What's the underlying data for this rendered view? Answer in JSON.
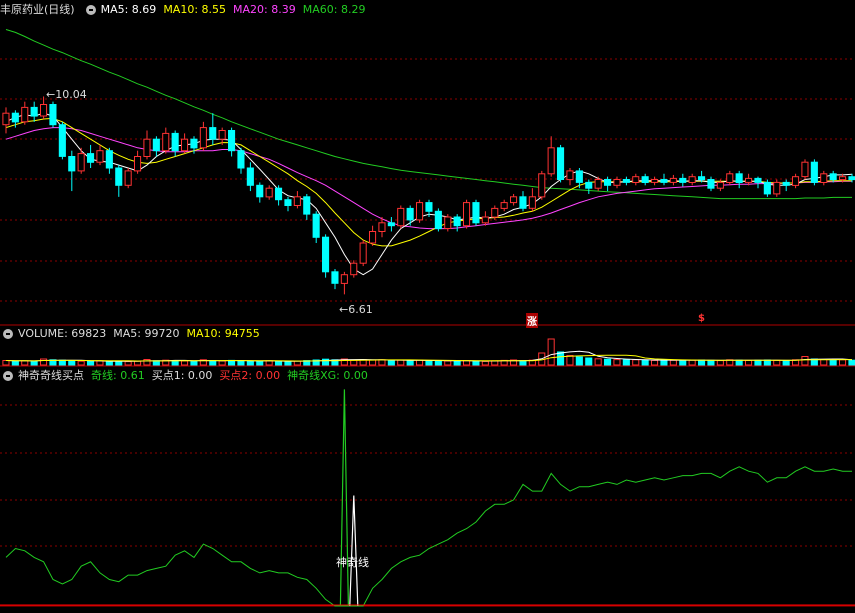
{
  "colors": {
    "ma5": "#ffffff",
    "ma10": "#ffff00",
    "ma20": "#ff44ff",
    "ma60": "#22cc22",
    "up": "#ff3333",
    "down": "#00ffff",
    "grid": "#8b0000",
    "qixian": "#22cc22"
  },
  "price_header": {
    "title": "丰原药业(日线)",
    "ma5": "MA5: 8.69",
    "ma10": "MA10: 8.55",
    "ma20": "MA20: 8.39",
    "ma60": "MA60: 8.29"
  },
  "volume_header": {
    "title": "VOLUME: 69823",
    "ma5": "MA5: 99720",
    "ma10": "MA10: 94755"
  },
  "indicator_header": {
    "title": "神奇奇线买点",
    "qixian": "奇线: 0.61",
    "buy1": "买点1: 0.00",
    "buy2": "买点2: 0.00",
    "xg": "神奇线XG: 0.00"
  },
  "annotations": {
    "high": "10.04",
    "low": "6.61",
    "indicator_label": "神奇线",
    "marker_zhang": "涨",
    "marker_dollar": "$"
  },
  "chart_data": [
    {
      "type": "candlestick",
      "title": "丰原药业(日线)",
      "ylim": [
        6.2,
        11.4
      ],
      "high_label": 10.04,
      "low_label": 6.61,
      "candles": [
        [
          9.55,
          9.75,
          9.4,
          9.85
        ],
        [
          9.75,
          9.6,
          9.5,
          9.8
        ],
        [
          9.6,
          9.85,
          9.55,
          9.95
        ],
        [
          9.85,
          9.7,
          9.6,
          9.95
        ],
        [
          9.7,
          9.9,
          9.65,
          10.04
        ],
        [
          9.9,
          9.55,
          9.5,
          9.95
        ],
        [
          9.55,
          9.0,
          8.95,
          9.6
        ],
        [
          9.0,
          8.75,
          8.4,
          9.1
        ],
        [
          8.75,
          9.05,
          8.7,
          9.15
        ],
        [
          9.05,
          8.9,
          8.8,
          9.2
        ],
        [
          8.9,
          9.1,
          8.85,
          9.2
        ],
        [
          9.1,
          8.8,
          8.7,
          9.15
        ],
        [
          8.8,
          8.5,
          8.3,
          8.85
        ],
        [
          8.5,
          8.75,
          8.45,
          8.8
        ],
        [
          8.75,
          9.0,
          8.7,
          9.1
        ],
        [
          9.0,
          9.3,
          8.95,
          9.45
        ],
        [
          9.3,
          9.1,
          9.0,
          9.35
        ],
        [
          9.1,
          9.4,
          9.05,
          9.5
        ],
        [
          9.4,
          9.1,
          9.0,
          9.45
        ],
        [
          9.1,
          9.3,
          9.05,
          9.4
        ],
        [
          9.3,
          9.15,
          9.05,
          9.35
        ],
        [
          9.15,
          9.5,
          9.1,
          9.6
        ],
        [
          9.5,
          9.3,
          9.2,
          9.75
        ],
        [
          9.3,
          9.45,
          9.2,
          9.5
        ],
        [
          9.45,
          9.1,
          9.0,
          9.5
        ],
        [
          9.1,
          8.8,
          8.7,
          9.15
        ],
        [
          8.8,
          8.5,
          8.4,
          8.9
        ],
        [
          8.5,
          8.3,
          8.2,
          8.55
        ],
        [
          8.3,
          8.45,
          8.25,
          8.5
        ],
        [
          8.45,
          8.25,
          8.15,
          8.5
        ],
        [
          8.25,
          8.15,
          8.05,
          8.3
        ],
        [
          8.15,
          8.3,
          8.1,
          8.4
        ],
        [
          8.3,
          8.0,
          7.9,
          8.35
        ],
        [
          8.0,
          7.6,
          7.5,
          8.05
        ],
        [
          7.6,
          7.0,
          6.9,
          7.65
        ],
        [
          7.0,
          6.8,
          6.7,
          7.05
        ],
        [
          6.8,
          6.95,
          6.61,
          7.0
        ],
        [
          6.95,
          7.15,
          6.9,
          7.2
        ],
        [
          7.15,
          7.5,
          7.1,
          7.55
        ],
        [
          7.5,
          7.7,
          7.45,
          7.8
        ],
        [
          7.7,
          7.85,
          7.6,
          7.95
        ],
        [
          7.85,
          7.8,
          7.7,
          7.95
        ],
        [
          7.8,
          8.1,
          7.75,
          8.15
        ],
        [
          8.1,
          7.9,
          7.8,
          8.15
        ],
        [
          7.9,
          8.2,
          7.85,
          8.25
        ],
        [
          8.2,
          8.05,
          7.95,
          8.25
        ],
        [
          8.05,
          7.75,
          7.7,
          8.1
        ],
        [
          7.75,
          7.95,
          7.7,
          8.0
        ],
        [
          7.95,
          7.8,
          7.7,
          8.0
        ],
        [
          7.8,
          8.2,
          7.75,
          8.25
        ],
        [
          8.2,
          7.85,
          7.8,
          8.25
        ],
        [
          7.85,
          7.95,
          7.8,
          8.05
        ],
        [
          7.95,
          8.1,
          7.9,
          8.15
        ],
        [
          8.1,
          8.2,
          8.05,
          8.25
        ],
        [
          8.2,
          8.3,
          8.15,
          8.35
        ],
        [
          8.3,
          8.1,
          8.05,
          8.4
        ],
        [
          8.1,
          8.3,
          8.05,
          8.45
        ],
        [
          8.3,
          8.7,
          8.25,
          8.75
        ],
        [
          8.7,
          9.15,
          8.65,
          9.35
        ],
        [
          9.15,
          8.6,
          8.55,
          9.2
        ],
        [
          8.6,
          8.75,
          8.5,
          8.8
        ],
        [
          8.75,
          8.55,
          8.45,
          8.8
        ],
        [
          8.55,
          8.45,
          8.35,
          8.6
        ],
        [
          8.45,
          8.6,
          8.4,
          8.65
        ],
        [
          8.6,
          8.5,
          8.4,
          8.65
        ],
        [
          8.5,
          8.6,
          8.45,
          8.65
        ],
        [
          8.6,
          8.55,
          8.5,
          8.65
        ],
        [
          8.55,
          8.65,
          8.5,
          8.7
        ],
        [
          8.65,
          8.55,
          8.5,
          8.7
        ],
        [
          8.55,
          8.6,
          8.5,
          8.65
        ],
        [
          8.6,
          8.55,
          8.5,
          8.7
        ],
        [
          8.55,
          8.62,
          8.5,
          8.68
        ],
        [
          8.62,
          8.55,
          8.48,
          8.7
        ],
        [
          8.55,
          8.65,
          8.5,
          8.7
        ],
        [
          8.65,
          8.6,
          8.55,
          8.75
        ],
        [
          8.6,
          8.45,
          8.4,
          8.65
        ],
        [
          8.45,
          8.55,
          8.4,
          8.6
        ],
        [
          8.55,
          8.7,
          8.5,
          8.75
        ],
        [
          8.7,
          8.55,
          8.45,
          8.75
        ],
        [
          8.55,
          8.62,
          8.5,
          8.7
        ],
        [
          8.62,
          8.55,
          8.45,
          8.65
        ],
        [
          8.55,
          8.35,
          8.3,
          8.6
        ],
        [
          8.35,
          8.55,
          8.3,
          8.6
        ],
        [
          8.55,
          8.5,
          8.4,
          8.6
        ],
        [
          8.5,
          8.65,
          8.45,
          8.7
        ],
        [
          8.65,
          8.9,
          8.6,
          8.95
        ],
        [
          8.9,
          8.55,
          8.5,
          8.95
        ],
        [
          8.55,
          8.7,
          8.5,
          8.75
        ],
        [
          8.7,
          8.6,
          8.55,
          8.75
        ],
        [
          8.6,
          8.65,
          8.55,
          8.7
        ],
        [
          8.65,
          8.6,
          8.55,
          8.7
        ]
      ],
      "ma5": [
        9.6,
        9.68,
        9.72,
        9.7,
        9.75,
        9.7,
        9.5,
        9.3,
        9.1,
        8.95,
        8.92,
        8.9,
        8.85,
        8.8,
        8.75,
        8.85,
        9.0,
        9.1,
        9.18,
        9.2,
        9.22,
        9.28,
        9.3,
        9.3,
        9.28,
        9.12,
        8.95,
        8.78,
        8.6,
        8.42,
        8.32,
        8.28,
        8.25,
        8.1,
        7.85,
        7.6,
        7.3,
        7.05,
        6.95,
        7.05,
        7.3,
        7.55,
        7.75,
        7.85,
        7.95,
        8.0,
        7.98,
        7.95,
        7.9,
        7.92,
        7.95,
        7.93,
        7.95,
        8.0,
        8.08,
        8.12,
        8.18,
        8.3,
        8.48,
        8.6,
        8.7,
        8.75,
        8.7,
        8.62,
        8.55,
        8.55,
        8.56,
        8.58,
        8.58,
        8.58,
        8.58,
        8.58,
        8.57,
        8.58,
        8.58,
        8.55,
        8.55,
        8.58,
        8.57,
        8.57,
        8.57,
        8.52,
        8.5,
        8.5,
        8.52,
        8.6,
        8.62,
        8.65,
        8.68,
        8.68,
        8.69
      ],
      "ma10": [
        9.5,
        9.55,
        9.6,
        9.62,
        9.65,
        9.66,
        9.6,
        9.5,
        9.4,
        9.3,
        9.2,
        9.1,
        9.02,
        8.95,
        8.9,
        8.88,
        8.9,
        8.95,
        9.0,
        9.05,
        9.1,
        9.15,
        9.2,
        9.24,
        9.24,
        9.2,
        9.1,
        9.0,
        8.9,
        8.8,
        8.7,
        8.58,
        8.48,
        8.36,
        8.2,
        8.02,
        7.85,
        7.68,
        7.55,
        7.48,
        7.45,
        7.45,
        7.5,
        7.55,
        7.62,
        7.7,
        7.78,
        7.85,
        7.88,
        7.9,
        7.92,
        7.93,
        7.94,
        7.95,
        7.98,
        8.02,
        8.05,
        8.12,
        8.22,
        8.32,
        8.42,
        8.5,
        8.55,
        8.56,
        8.56,
        8.56,
        8.56,
        8.56,
        8.56,
        8.56,
        8.56,
        8.56,
        8.57,
        8.57,
        8.57,
        8.57,
        8.57,
        8.57,
        8.57,
        8.57,
        8.57,
        8.55,
        8.54,
        8.54,
        8.54,
        8.56,
        8.56,
        8.57,
        8.58,
        8.58,
        8.58
      ],
      "ma20": [
        9.3,
        9.35,
        9.4,
        9.45,
        9.48,
        9.5,
        9.5,
        9.48,
        9.45,
        9.4,
        9.35,
        9.3,
        9.25,
        9.2,
        9.15,
        9.12,
        9.1,
        9.08,
        9.08,
        9.08,
        9.1,
        9.1,
        9.1,
        9.12,
        9.12,
        9.1,
        9.05,
        9.0,
        8.95,
        8.88,
        8.8,
        8.72,
        8.65,
        8.58,
        8.5,
        8.4,
        8.3,
        8.2,
        8.1,
        8.0,
        7.92,
        7.85,
        7.8,
        7.78,
        7.76,
        7.75,
        7.75,
        7.75,
        7.76,
        7.78,
        7.8,
        7.82,
        7.84,
        7.86,
        7.88,
        7.9,
        7.93,
        7.97,
        8.02,
        8.08,
        8.14,
        8.2,
        8.25,
        8.3,
        8.33,
        8.36,
        8.38,
        8.4,
        8.42,
        8.44,
        8.45,
        8.46,
        8.47,
        8.48,
        8.49,
        8.5,
        8.5,
        8.51,
        8.52,
        8.52,
        8.53,
        8.53,
        8.53,
        8.54,
        8.54,
        8.55,
        8.55,
        8.56,
        8.56,
        8.57,
        8.57
      ],
      "ma60": [
        11.2,
        11.15,
        11.08,
        11.0,
        10.93,
        10.86,
        10.8,
        10.73,
        10.66,
        10.6,
        10.53,
        10.46,
        10.4,
        10.33,
        10.26,
        10.2,
        10.13,
        10.06,
        10.0,
        9.93,
        9.86,
        9.8,
        9.73,
        9.67,
        9.6,
        9.54,
        9.48,
        9.42,
        9.36,
        9.3,
        9.25,
        9.2,
        9.15,
        9.1,
        9.05,
        9.0,
        8.96,
        8.92,
        8.88,
        8.85,
        8.82,
        8.79,
        8.76,
        8.74,
        8.72,
        8.7,
        8.68,
        8.66,
        8.64,
        8.62,
        8.6,
        8.58,
        8.56,
        8.54,
        8.52,
        8.5,
        8.48,
        8.46,
        8.45,
        8.44,
        8.43,
        8.42,
        8.41,
        8.4,
        8.39,
        8.38,
        8.37,
        8.36,
        8.35,
        8.34,
        8.33,
        8.32,
        8.31,
        8.3,
        8.29,
        8.28,
        8.27,
        8.27,
        8.27,
        8.27,
        8.27,
        8.27,
        8.27,
        8.27,
        8.27,
        8.28,
        8.28,
        8.28,
        8.29,
        8.29,
        8.29
      ]
    },
    {
      "type": "bar",
      "title": "VOLUME",
      "volume": [
        45,
        40,
        42,
        38,
        60,
        52,
        48,
        40,
        38,
        35,
        42,
        36,
        40,
        34,
        38,
        55,
        42,
        48,
        45,
        40,
        38,
        52,
        44,
        40,
        46,
        42,
        40,
        38,
        42,
        36,
        34,
        40,
        44,
        50,
        58,
        52,
        60,
        48,
        55,
        50,
        52,
        42,
        48,
        40,
        50,
        45,
        42,
        40,
        38,
        44,
        40,
        36,
        42,
        46,
        50,
        44,
        48,
        120,
        260,
        130,
        95,
        80,
        70,
        62,
        58,
        54,
        50,
        52,
        48,
        46,
        50,
        47,
        44,
        48,
        50,
        46,
        44,
        52,
        48,
        45,
        47,
        50,
        46,
        44,
        52,
        85,
        60,
        55,
        50,
        52,
        48
      ],
      "ma5_last": 99720,
      "ma10_last": 94755,
      "last": 69823
    },
    {
      "type": "line",
      "title": "神奇奇线买点",
      "ylim": [
        0,
        1.0
      ],
      "qixian": [
        0.22,
        0.26,
        0.25,
        0.22,
        0.2,
        0.12,
        0.1,
        0.12,
        0.18,
        0.2,
        0.15,
        0.12,
        0.11,
        0.14,
        0.14,
        0.16,
        0.17,
        0.18,
        0.23,
        0.25,
        0.22,
        0.28,
        0.26,
        0.23,
        0.2,
        0.2,
        0.17,
        0.15,
        0.16,
        0.15,
        0.15,
        0.13,
        0.12,
        0.08,
        0.03,
        0.0,
        0.0,
        0.0,
        0.0,
        0.08,
        0.12,
        0.17,
        0.2,
        0.22,
        0.23,
        0.26,
        0.28,
        0.3,
        0.33,
        0.35,
        0.38,
        0.43,
        0.46,
        0.46,
        0.48,
        0.55,
        0.52,
        0.52,
        0.6,
        0.55,
        0.52,
        0.54,
        0.54,
        0.55,
        0.56,
        0.55,
        0.57,
        0.56,
        0.57,
        0.58,
        0.57,
        0.58,
        0.59,
        0.59,
        0.6,
        0.6,
        0.58,
        0.61,
        0.63,
        0.61,
        0.6,
        0.56,
        0.58,
        0.58,
        0.61,
        0.63,
        0.61,
        0.61,
        0.62,
        0.61,
        0.61
      ],
      "xg": [
        {
          "index": 36,
          "value": 0.98
        },
        {
          "index": 37,
          "value": 0.5
        }
      ]
    }
  ]
}
